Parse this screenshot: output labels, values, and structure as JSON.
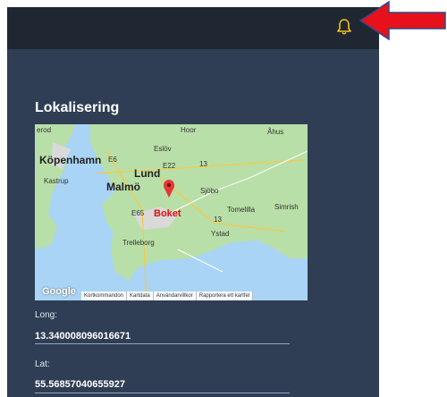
{
  "header": {
    "notification_icon": "bell-icon",
    "accent_color": "#f2c31a"
  },
  "annotation": {
    "arrow_color": "#e8101b",
    "arrow_icon": "left-arrow-icon"
  },
  "section": {
    "title": "Lokalisering"
  },
  "map": {
    "labels": {
      "lerod": "erod",
      "hoor": "Hoor",
      "ahus": "Åhus",
      "eslov": "Eslöv",
      "e6": "E6",
      "e22": "E22",
      "r13": "13",
      "kopenhamn": "Köpenhamn",
      "lund": "Lund",
      "kastrup": "Kastrup",
      "malmo": "Malmö",
      "e65": "E65",
      "sjobo": "Sjöbo",
      "boket": "Boket",
      "tomelilla": "Tomelilla",
      "simrishamn": "Simrish",
      "ystad": "Ystad",
      "trelleborg": "Trelleborg",
      "r13b": "13"
    },
    "marker_color": "#e53935",
    "google_logo": "Google",
    "attribution": [
      "Kortkommandon",
      "Kartdata",
      "Användarvillkor",
      "Rapportera ett kartfel"
    ]
  },
  "fields": {
    "long_label": "Long:",
    "long_value": "13.340008096016671",
    "lat_label": "Lat:",
    "lat_value": "55.56857040655927"
  }
}
